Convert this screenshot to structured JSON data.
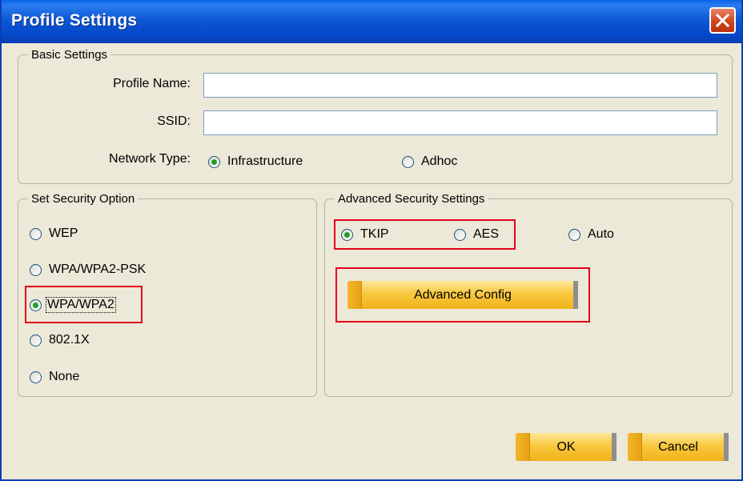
{
  "window": {
    "title": "Profile Settings"
  },
  "basic_settings": {
    "legend": "Basic Settings",
    "profile_name_label": "Profile Name:",
    "profile_name_value": "",
    "ssid_label": "SSID:",
    "ssid_value": "",
    "network_type_label": "Network Type:",
    "network_type_options": [
      "Infrastructure",
      "Adhoc"
    ],
    "network_type_selected": "Infrastructure"
  },
  "security_option": {
    "legend": "Set Security Option",
    "options": [
      "WEP",
      "WPA/WPA2-PSK",
      "WPA/WPA2",
      "802.1X",
      "None"
    ],
    "selected": "WPA/WPA2"
  },
  "advanced_security": {
    "legend": "Advanced Security Settings",
    "options": [
      "TKIP",
      "AES",
      "Auto"
    ],
    "selected": "TKIP",
    "advanced_config_label": "Advanced Config"
  },
  "footer": {
    "ok_label": "OK",
    "cancel_label": "Cancel"
  },
  "colors": {
    "titlebar": "#0a58d4",
    "dialog_bg": "#ece9d8",
    "highlight_box": "#e4001b",
    "button_gold": "#f8c83f"
  }
}
